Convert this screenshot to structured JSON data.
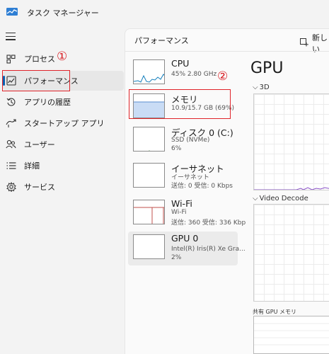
{
  "app": {
    "title": "タスク マネージャー"
  },
  "sidebar": {
    "items": [
      {
        "label": "プロセス",
        "icon": "grid-icon"
      },
      {
        "label": "パフォーマンス",
        "icon": "performance-icon"
      },
      {
        "label": "アプリの履歴",
        "icon": "history-icon"
      },
      {
        "label": "スタートアップ アプリ",
        "icon": "startup-icon"
      },
      {
        "label": "ユーザー",
        "icon": "users-icon"
      },
      {
        "label": "詳細",
        "icon": "list-icon"
      },
      {
        "label": "サービス",
        "icon": "gear-icon"
      }
    ]
  },
  "annotations": {
    "one": "①",
    "two": "②"
  },
  "main": {
    "header": "パフォーマンス",
    "new_task_label": "新しい"
  },
  "perf_list": [
    {
      "name": "CPU",
      "sub1": "45%  2.80 GHz",
      "sub2": ""
    },
    {
      "name": "メモリ",
      "sub1": "10.9/15.7 GB (69%)",
      "sub2": ""
    },
    {
      "name": "ディスク 0 (C:)",
      "sub1": "SSD (NVMe)",
      "sub2": "6%"
    },
    {
      "name": "イーサネット",
      "sub1": "イーサネット",
      "sub2": "送信: 0  受信: 0 Kbps"
    },
    {
      "name": "Wi-Fi",
      "sub1": "Wi-Fi",
      "sub2": "送信: 360  受信: 336 Kbp"
    },
    {
      "name": "GPU 0",
      "sub1": "Intel(R) Iris(R) Xe Gra...",
      "sub2": "2%"
    }
  ],
  "gpu_panel": {
    "title": "GPU",
    "graph1_label": "3D",
    "graph2_label": "Video Decode",
    "shared_memory_label": "共有 GPU メモリ"
  },
  "colors": {
    "accent": "#0a5fb0",
    "annotation_red": "#e0242a",
    "cpu_line": "#117dbb",
    "memory_fill": "#c9dcf5",
    "memory_line": "#5b8fd1",
    "wifi_line": "#c0504d",
    "gpu_line": "#8a50c8"
  }
}
